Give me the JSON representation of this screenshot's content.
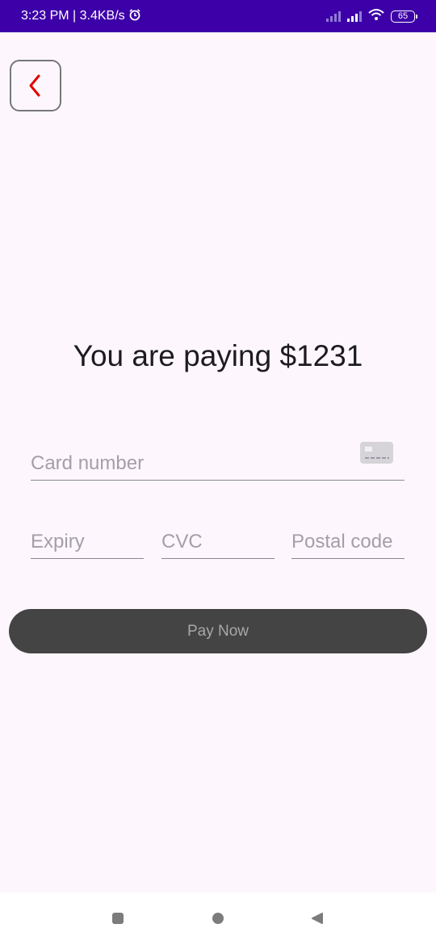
{
  "status_bar": {
    "time_speed": "3:23 PM | 3.4KB/s",
    "battery": "65",
    "icons": [
      "alarm-icon",
      "signal-icon",
      "signal-icon",
      "wifi-icon",
      "battery-icon"
    ]
  },
  "header": {
    "back_icon": "chevron-left-icon",
    "back_icon_color": "#e00000"
  },
  "payment": {
    "title": "You are paying $1231",
    "card_number_placeholder": "Card number",
    "expiry_placeholder": "Expiry",
    "cvc_placeholder": "CVC",
    "postal_code_placeholder": "Postal code",
    "card_icon": "credit-card-icon",
    "pay_button_label": "Pay Now"
  },
  "nav_bar": {
    "icons": [
      "recents-icon",
      "home-icon",
      "back-icon"
    ]
  },
  "colors": {
    "status_bar": "#3d00a8",
    "background": "#fdf7fd",
    "pay_button": "#444444"
  }
}
